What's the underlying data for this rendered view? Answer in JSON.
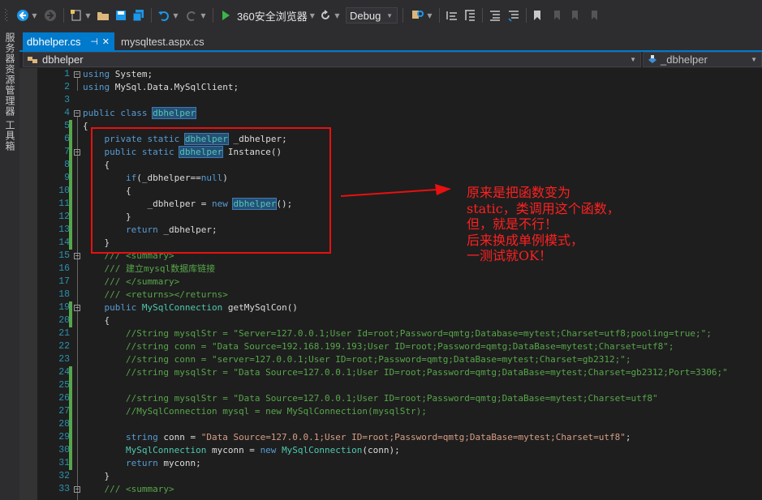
{
  "toolbar": {
    "run_target": "360安全浏览器",
    "configuration": "Debug"
  },
  "side_strip": {
    "server_explorer": "服务器资源管理器",
    "toolbox": "工具箱"
  },
  "tabs": [
    {
      "label": "dbhelper.cs",
      "active": true
    },
    {
      "label": "mysqltest.aspx.cs",
      "active": false
    }
  ],
  "navbar": {
    "left": "dbhelper",
    "right": "_dbhelper"
  },
  "editor": {
    "line_numbers": [
      "1",
      "2",
      "3",
      "4",
      "5",
      "6",
      "7",
      "8",
      "9",
      "10",
      "11",
      "12",
      "13",
      "14",
      "15",
      "16",
      "17",
      "18",
      "19",
      "20",
      "21",
      "22",
      "23",
      "24",
      "25",
      "26",
      "27",
      "28",
      "29",
      "30",
      "31",
      "32",
      "33"
    ]
  },
  "annotation": {
    "text": "原来是把函数变为\nstatic，类调用这个函数，\n但，就是不行！\n后来换成单例模式，\n一测试就OK！"
  },
  "colors": {
    "accent": "#007acc",
    "background": "#1e1e1e",
    "keyword": "#569cd6",
    "type": "#4ec9b0",
    "comment": "#57a64a",
    "string": "#d69d85",
    "annotation_red": "#ff2020"
  }
}
